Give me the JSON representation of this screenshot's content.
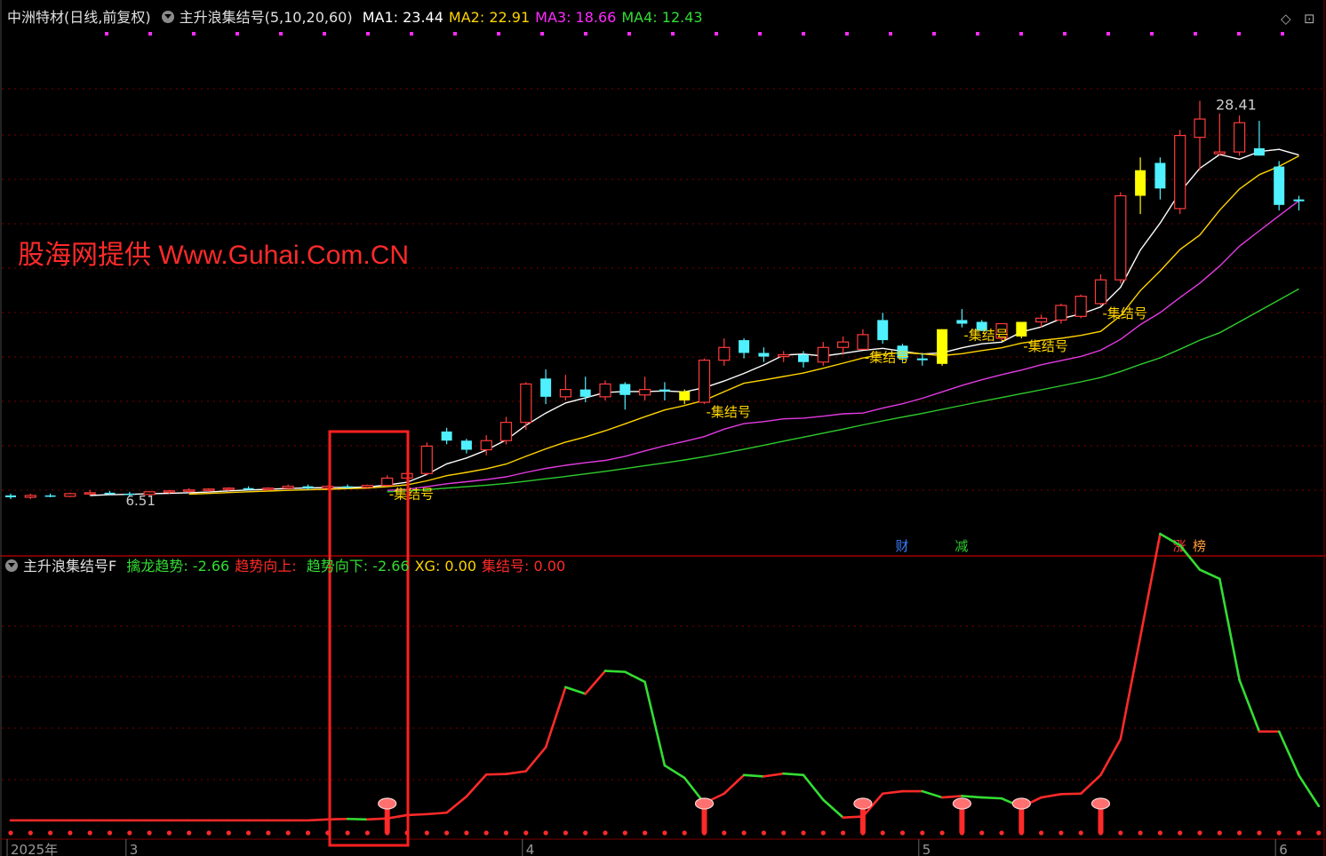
{
  "header": {
    "stock": "中洲特材",
    "period": "(日线,前复权)",
    "indicator": "主升浪集结号(5,10,20,60)",
    "ma": [
      {
        "label": "MA1:",
        "value": "23.44",
        "color": "#ffffff"
      },
      {
        "label": "MA2:",
        "value": "22.91",
        "color": "#ffd400"
      },
      {
        "label": "MA3:",
        "value": "18.66",
        "color": "#ff2bff"
      },
      {
        "label": "MA4:",
        "value": "12.43",
        "color": "#33dd33"
      }
    ]
  },
  "indicator_header": {
    "name": "主升浪集结号F",
    "fields": [
      {
        "label": "擒龙趋势:",
        "value": "-2.66",
        "color": "#33dd33"
      },
      {
        "label": "趋势向上:",
        "value": "",
        "color": "#ff2a2a"
      },
      {
        "label": "趋势向下:",
        "value": "-2.66",
        "color": "#33dd33"
      },
      {
        "label": "XG:",
        "value": "0.00",
        "color": "#ffd400"
      },
      {
        "label": "集结号:",
        "value": "0.00",
        "color": "#ff2a2a"
      }
    ]
  },
  "watermark": "股海网提供 Www.Guhai.Com.CN",
  "colors": {
    "up": "#ff3b3b",
    "down": "#4ff0ff",
    "signal": "#ffff00",
    "ma1": "#ffffff",
    "ma2": "#ffd400",
    "ma3": "#e23be2",
    "ma4": "#2ecc2e",
    "grid": "#7a0000",
    "frame": "#7a0000"
  },
  "icons": [
    "diamond-icon",
    "maximize-icon"
  ],
  "chart_data": [
    {
      "type": "candlestick",
      "title": "中洲特材 日线",
      "ylim": [
        5,
        31
      ],
      "max_label": "28.41",
      "min_label": "6.51",
      "x_ticks": [
        {
          "index": 0,
          "label": "2025年"
        },
        {
          "index": 6,
          "label": "3"
        },
        {
          "index": 26,
          "label": "4"
        },
        {
          "index": 46,
          "label": "5"
        },
        {
          "index": 64,
          "label": "6"
        }
      ],
      "candles": [
        [
          6.8,
          6.9,
          6.6,
          6.7
        ],
        [
          6.7,
          6.9,
          6.6,
          6.8
        ],
        [
          6.8,
          6.9,
          6.7,
          6.75
        ],
        [
          6.75,
          6.95,
          6.7,
          6.9
        ],
        [
          6.9,
          7.1,
          6.8,
          6.95
        ],
        [
          6.95,
          7.05,
          6.85,
          6.9
        ],
        [
          6.9,
          7.0,
          6.75,
          6.85
        ],
        [
          6.85,
          7.05,
          6.8,
          7.0
        ],
        [
          7.0,
          7.1,
          6.9,
          7.05
        ],
        [
          7.05,
          7.2,
          6.95,
          7.1
        ],
        [
          7.1,
          7.2,
          7.0,
          7.15
        ],
        [
          7.15,
          7.25,
          7.05,
          7.2
        ],
        [
          7.2,
          7.3,
          7.1,
          7.15
        ],
        [
          7.15,
          7.25,
          7.05,
          7.2
        ],
        [
          7.2,
          7.4,
          7.1,
          7.3
        ],
        [
          7.3,
          7.4,
          7.1,
          7.2
        ],
        [
          7.2,
          7.35,
          7.1,
          7.3
        ],
        [
          7.3,
          7.4,
          7.15,
          7.25
        ],
        [
          7.25,
          7.4,
          7.15,
          7.35
        ],
        [
          7.35,
          7.9,
          7.3,
          7.75
        ],
        [
          7.75,
          8.2,
          7.6,
          8.0
        ],
        [
          8.0,
          9.7,
          7.9,
          9.5
        ],
        [
          10.3,
          10.5,
          9.6,
          9.8
        ],
        [
          9.8,
          9.9,
          9.1,
          9.3
        ],
        [
          9.3,
          10.1,
          9.0,
          9.8
        ],
        [
          9.8,
          11.1,
          9.6,
          10.8
        ],
        [
          10.8,
          13.0,
          10.4,
          12.9
        ],
        [
          13.2,
          13.7,
          11.8,
          12.2
        ],
        [
          12.2,
          13.4,
          12.0,
          12.6
        ],
        [
          12.6,
          13.3,
          11.9,
          12.2
        ],
        [
          12.2,
          13.1,
          12.0,
          12.9
        ],
        [
          12.9,
          13.0,
          11.5,
          12.3
        ],
        [
          12.3,
          13.3,
          12.0,
          12.6
        ],
        [
          12.6,
          13.0,
          12.0,
          12.5
        ],
        [
          12.5,
          12.6,
          11.8,
          12.0
        ],
        [
          11.9,
          14.3,
          11.8,
          14.2
        ],
        [
          14.2,
          15.4,
          13.9,
          14.9
        ],
        [
          15.3,
          15.4,
          14.3,
          14.6
        ],
        [
          14.6,
          14.9,
          14.1,
          14.4
        ],
        [
          14.4,
          14.7,
          14.1,
          14.5
        ],
        [
          14.5,
          14.7,
          13.8,
          14.1
        ],
        [
          14.1,
          15.2,
          13.9,
          14.9
        ],
        [
          14.9,
          15.5,
          14.5,
          15.2
        ],
        [
          14.8,
          15.9,
          14.8,
          15.6
        ],
        [
          16.4,
          16.8,
          15.1,
          15.3
        ],
        [
          15.0,
          15.1,
          14.1,
          14.3
        ],
        [
          14.3,
          14.6,
          13.9,
          14.2
        ],
        [
          14.0,
          15.9,
          13.9,
          15.9
        ],
        [
          16.4,
          17.0,
          16.0,
          16.2
        ],
        [
          16.3,
          16.4,
          15.9,
          15.8
        ],
        [
          15.4,
          16.2,
          15.3,
          16.2
        ],
        [
          15.5,
          16.3,
          15.4,
          16.3
        ],
        [
          16.3,
          16.7,
          16.0,
          16.5
        ],
        [
          16.4,
          17.3,
          16.2,
          17.2
        ],
        [
          16.6,
          17.8,
          16.5,
          17.7
        ],
        [
          17.3,
          18.9,
          17.2,
          18.6
        ],
        [
          18.6,
          23.4,
          18.4,
          23.2
        ],
        [
          23.2,
          25.3,
          22.2,
          24.6
        ],
        [
          25.0,
          25.3,
          23.0,
          23.6
        ],
        [
          22.5,
          26.8,
          22.2,
          26.5
        ],
        [
          26.4,
          28.4,
          24.6,
          27.4
        ],
        [
          25.5,
          27.7,
          25.4,
          25.6
        ],
        [
          25.6,
          27.6,
          25.4,
          27.2
        ],
        [
          25.8,
          27.3,
          25.4,
          25.4
        ],
        [
          24.8,
          25.1,
          22.4,
          22.7
        ],
        [
          23.0,
          23.2,
          22.4,
          22.9
        ]
      ],
      "signal_indices": [
        34,
        47,
        51,
        57
      ],
      "labels": [
        {
          "index": 19,
          "text": "集结号"
        },
        {
          "index": 35,
          "text": "集结号"
        },
        {
          "index": 43,
          "text": "集结号"
        },
        {
          "index": 48,
          "text": "集结号"
        },
        {
          "index": 51,
          "text": "集结号"
        },
        {
          "index": 55,
          "text": "集结号"
        }
      ],
      "events": [
        {
          "index": 45,
          "text": "财",
          "color": "#3c7dff"
        },
        {
          "index": 48,
          "text": "减",
          "color": "#2ecc2e"
        },
        {
          "index": 59,
          "text": "涨",
          "color": "#ff3b3b"
        },
        {
          "index": 60,
          "text": "榜",
          "color": "#ff9c3b"
        }
      ],
      "series": [
        {
          "name": "MA1",
          "values": [
            null,
            null,
            null,
            null,
            6.8,
            6.84,
            6.86,
            6.89,
            6.92,
            6.95,
            6.99,
            7.05,
            7.1,
            7.14,
            7.18,
            7.21,
            7.23,
            7.24,
            7.26,
            7.37,
            7.52,
            7.95,
            8.53,
            8.85,
            9.28,
            9.84,
            10.64,
            11.31,
            11.86,
            12.14,
            12.44,
            12.49,
            12.49,
            12.52,
            12.47,
            12.7,
            13.06,
            13.48,
            13.94,
            14.48,
            14.54,
            14.43,
            14.58,
            14.74,
            14.85,
            14.69,
            14.54,
            14.61,
            14.88,
            15.1,
            15.19,
            15.75,
            16.02,
            16.48,
            16.73,
            17.12,
            18.19,
            20.23,
            21.71,
            23.4,
            24.7,
            25.46,
            25.2,
            25.62,
            25.74,
            25.43
          ]
        },
        {
          "name": "MA2",
          "values": [
            null,
            null,
            null,
            null,
            null,
            null,
            null,
            null,
            null,
            6.87,
            6.91,
            6.96,
            7.0,
            7.04,
            7.08,
            7.11,
            7.14,
            7.17,
            7.2,
            7.28,
            7.38,
            7.6,
            7.88,
            8.06,
            8.26,
            8.52,
            8.94,
            9.35,
            9.72,
            10.0,
            10.34,
            10.72,
            11.11,
            11.48,
            11.72,
            12.01,
            12.48,
            12.94,
            13.12,
            13.31,
            13.5,
            13.76,
            14.04,
            14.32,
            14.53,
            14.62,
            14.55,
            14.45,
            14.56,
            14.73,
            14.88,
            15.14,
            15.29,
            15.4,
            15.56,
            15.78,
            16.64,
            18.01,
            19.09,
            20.26,
            21.05,
            22.41,
            23.57,
            24.35,
            24.81,
            25.38
          ]
        },
        {
          "name": "MA3",
          "values": [
            null,
            null,
            null,
            null,
            null,
            null,
            null,
            null,
            null,
            null,
            null,
            null,
            null,
            null,
            null,
            null,
            null,
            null,
            null,
            7.08,
            7.13,
            7.28,
            7.44,
            7.55,
            7.67,
            7.82,
            8.06,
            8.28,
            8.45,
            8.59,
            8.72,
            8.94,
            9.24,
            9.52,
            9.76,
            10.02,
            10.43,
            10.73,
            10.84,
            10.99,
            11.03,
            11.14,
            11.27,
            11.31,
            11.58,
            11.82,
            12.12,
            12.47,
            12.82,
            13.13,
            13.41,
            13.66,
            13.95,
            14.18,
            14.41,
            14.75,
            15.34,
            16.15,
            16.81,
            17.63,
            18.42,
            19.35,
            20.44,
            21.28,
            22.11,
            22.93
          ]
        },
        {
          "name": "MA4",
          "values": [
            null,
            null,
            null,
            null,
            null,
            null,
            null,
            null,
            null,
            null,
            null,
            null,
            null,
            null,
            null,
            null,
            null,
            null,
            null,
            7.0,
            7.05,
            7.12,
            7.2,
            7.28,
            7.36,
            7.46,
            7.58,
            7.71,
            7.84,
            7.98,
            8.12,
            8.27,
            8.43,
            8.58,
            8.74,
            8.92,
            9.12,
            9.33,
            9.55,
            9.77,
            9.99,
            10.21,
            10.43,
            10.66,
            10.88,
            11.09,
            11.29,
            11.51,
            11.73,
            11.95,
            12.16,
            12.37,
            12.58,
            12.8,
            13.02,
            13.25,
            13.58,
            13.97,
            14.33,
            14.8,
            15.3,
            15.7,
            16.3,
            16.9,
            17.5,
            18.1
          ]
        }
      ]
    },
    {
      "type": "line",
      "title": "主升浪集结号F",
      "ylim": [
        -3,
        50
      ],
      "up_color": "#ff2a2a",
      "down_color": "#33dd33",
      "values": [
        0,
        0,
        0,
        0,
        0,
        0,
        0,
        0,
        0,
        0,
        0,
        0,
        0,
        0,
        0,
        0,
        0.2,
        0.3,
        0.2,
        0.4,
        1.1,
        1.3,
        1.6,
        5.0,
        9.6,
        9.7,
        10.3,
        15.3,
        27.9,
        26.5,
        31.3,
        31.1,
        29.0,
        11.5,
        8.9,
        3.6,
        5.6,
        9.5,
        9.2,
        9.8,
        9.5,
        4.3,
        0.6,
        0.8,
        5.6,
        6.1,
        6.1,
        4.8,
        5.1,
        4.8,
        4.6,
        2.8,
        4.8,
        5.5,
        5.6,
        9.5,
        17.0,
        38.4,
        60.0,
        57.6,
        52.5,
        50.6,
        29.4,
        18.6,
        18.6,
        9.4,
        3.0
      ]
    }
  ]
}
